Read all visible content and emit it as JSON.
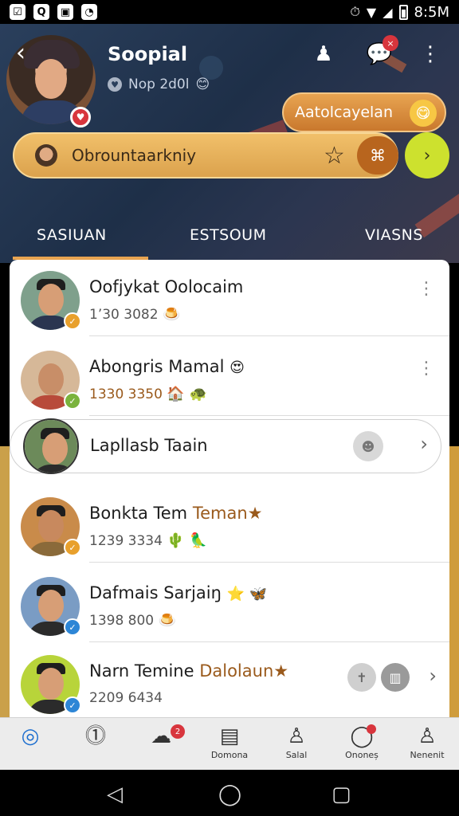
{
  "status_bar": {
    "time": "8:5M",
    "left_icons": [
      "app-icon-1",
      "q-icon",
      "app-icon-3",
      "clock-icon"
    ],
    "left_glyphs": [
      "☑",
      "Q",
      "▣",
      "◔"
    ]
  },
  "header": {
    "title": "Soopial",
    "subtitle": "Nop 2d0l",
    "subtitle_emoji": "😊",
    "pill_button_label": "Aatolcayelan",
    "pill_emoji": "😋",
    "chat_badge": "×"
  },
  "search": {
    "text": "Obrountaarkniy",
    "star_glyph": "☆",
    "map_glyph": "⌘",
    "go_glyph": "›"
  },
  "tabs": [
    "SASIUAN",
    "ESTSOUM",
    "VIASNS"
  ],
  "contacts": [
    {
      "name": "Oofjykat Oolocaim",
      "name_highlight": "",
      "number": "1’30 3082",
      "emojis": "🍮",
      "badge_color": "#e8a02c",
      "bg": "#7fa08c",
      "shirt": "#2a3550",
      "has_more": true
    },
    {
      "name": "Abongris Mamal",
      "name_highlight": "",
      "number": "1330 3350",
      "emojis": "😍 🏠 🐢",
      "badge_color": "#7ab33d",
      "bg": "#d6b898",
      "shirt": "#b84a3a",
      "has_more": true,
      "orange_number": true
    },
    {
      "name": "Lapllasb Taain",
      "name_highlight": "",
      "number": "",
      "emojis": "",
      "badge_color": "",
      "bg": "#6c8a5a",
      "shirt": "#2b2b2b",
      "highlighted": true
    },
    {
      "name": "Bonkta Tem ",
      "name_highlight": "Teman",
      "name_suffix": "★",
      "number": "1239 3334",
      "emojis": "🌵 🦜",
      "badge_color": "#e8a02c",
      "bg": "#c98b4a",
      "shirt": "#8a6a3a"
    },
    {
      "name": "Dafmais Sarjaiŋ",
      "name_highlight": "",
      "name_suffix": "⭐ 🦋",
      "number": "1398 800",
      "emojis": "🍮",
      "badge_color": "#2d86d6",
      "bg": "#7a9cc4",
      "shirt": "#2b2b2b"
    },
    {
      "name": "Narn Temine ",
      "name_highlight": "Dalolaun",
      "name_suffix": "★",
      "number": "2209 6434",
      "emojis": "",
      "badge_color": "#2d86d6",
      "bg": "#b8d43a",
      "shirt": "#2b2b2b",
      "has_actions": true
    }
  ],
  "bottom_nav": [
    {
      "glyph": "◎",
      "label": "",
      "active": true
    },
    {
      "glyph": "⓵",
      "label": ""
    },
    {
      "glyph": "☁",
      "label": "",
      "badge": "2"
    },
    {
      "glyph": "▤",
      "label": "Domona"
    },
    {
      "glyph": "♙",
      "label": "Salal"
    },
    {
      "glyph": "◯",
      "label": "Ononeș"
    },
    {
      "glyph": "♙",
      "label": "Nenenit"
    }
  ],
  "system_nav": [
    "◁",
    "◯",
    "▢"
  ]
}
